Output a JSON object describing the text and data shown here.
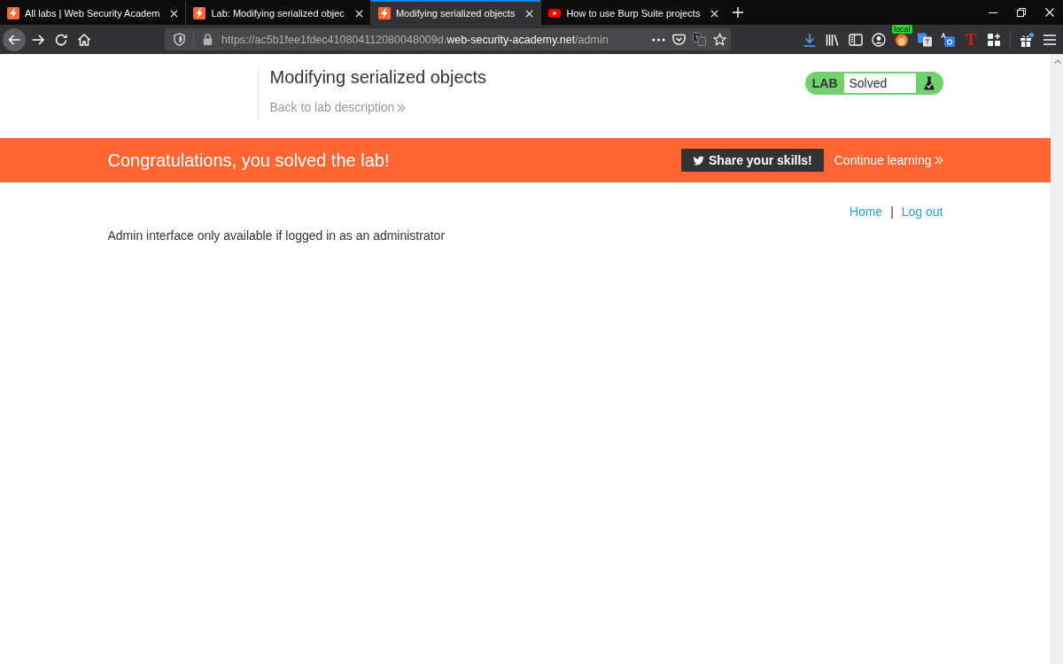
{
  "browser": {
    "tabs": [
      {
        "kind": "lightning",
        "title": "All labs | Web Security Academ",
        "selected": false
      },
      {
        "kind": "lightning",
        "title": "Lab: Modifying serialized objec",
        "selected": false
      },
      {
        "kind": "lightning",
        "title": "Modifying serialized objects",
        "selected": true
      },
      {
        "kind": "play",
        "title": "How to use Burp Suite projects",
        "selected": false
      }
    ],
    "address": {
      "scheme_and_subdomain": "https://ac5b1fee1fdec410804112080048009d.",
      "domain": "web-security-academy.net",
      "path": "/admin"
    },
    "extension_badge": "local",
    "extension_letter": "T"
  },
  "lab_header": {
    "title": "Modifying serialized objects",
    "back_link": "Back to lab description",
    "status": {
      "label": "LAB",
      "value": "Solved",
      "solved": true
    }
  },
  "banner": {
    "message": "Congratulations, you solved the lab!",
    "share_button": "Share your skills!",
    "continue_link": "Continue learning"
  },
  "account_links": {
    "items": [
      "Home",
      "Log out"
    ],
    "separator": "|"
  },
  "message": "Admin interface only available if logged in as an administrator"
}
